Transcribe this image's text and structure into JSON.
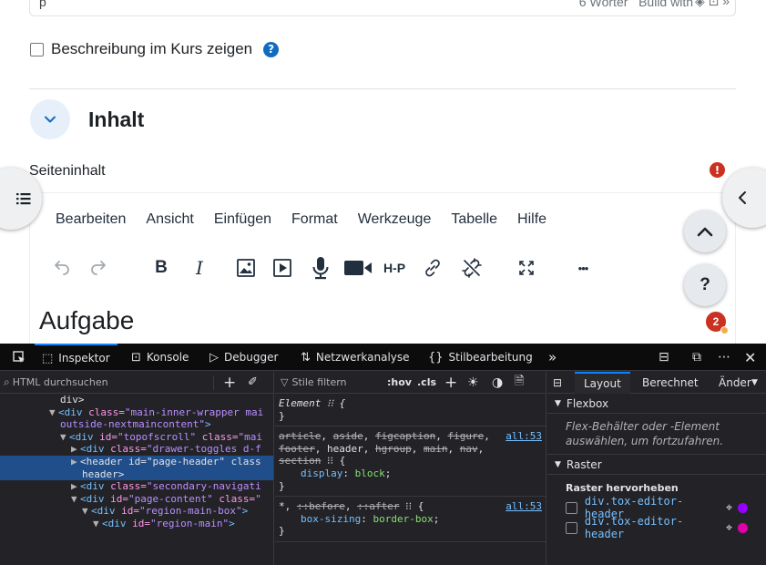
{
  "page": {
    "top_field": {
      "text": "p",
      "word_count": "6 Wörter",
      "build_with": "Build with"
    },
    "checkbox_label": "Beschreibung im Kurs zeigen",
    "help_icon": "?",
    "section_title": "Inhalt",
    "field_label": "Seiteninhalt",
    "required_icon": "!",
    "editor": {
      "menu": [
        "Bearbeiten",
        "Ansicht",
        "Einfügen",
        "Format",
        "Werkzeuge",
        "Tabelle",
        "Hilfe"
      ],
      "toolbar": [
        "undo-icon",
        "redo-icon",
        "bold-icon",
        "italic-icon",
        "image-icon",
        "media-icon",
        "microphone-icon",
        "video-icon",
        "h5p-icon",
        "link-icon",
        "unlink-icon",
        "fullscreen-icon",
        "more-icon"
      ],
      "bold_label": "B",
      "italic_label": "I",
      "h5p_label": "H-P",
      "more_label": "•••",
      "body_text": "Aufgabe"
    },
    "question_label": "?",
    "notification_count": "2",
    "colors": {
      "primary": "#0f6cbf",
      "danger": "#ca3120",
      "warning": "#f0ad4e"
    }
  },
  "devtools": {
    "tabs": [
      {
        "label": "Inspektor",
        "icon": "inspector-icon"
      },
      {
        "label": "Konsole",
        "icon": "console-icon"
      },
      {
        "label": "Debugger",
        "icon": "debugger-icon"
      },
      {
        "label": "Netzwerkanalyse",
        "icon": "network-icon"
      },
      {
        "label": "Stilbearbeitung",
        "icon": "style-editor-icon"
      }
    ],
    "more_tabs": "»",
    "html_search_placeholder": "HTML durchsuchen",
    "html_tree": [
      {
        "indent": 0,
        "parts": [
          [
            "txt",
            "div>"
          ]
        ]
      },
      {
        "indent": 1,
        "tri": "▼",
        "parts": [
          [
            "tag",
            "<div "
          ],
          [
            "attr",
            "class="
          ],
          [
            "val",
            "\"main-inner-wrapper mai"
          ]
        ]
      },
      {
        "indent": 1,
        "parts": [
          [
            "val",
            "outside-nextmaincontent\""
          ],
          [
            "tag",
            ">"
          ]
        ]
      },
      {
        "indent": 2,
        "tri": "▼",
        "parts": [
          [
            "tag",
            "<div "
          ],
          [
            "attr",
            "id="
          ],
          [
            "val",
            "\"topofscroll\" "
          ],
          [
            "attr",
            "class="
          ],
          [
            "val",
            "\"mai"
          ]
        ]
      },
      {
        "indent": 3,
        "tri": "▶",
        "parts": [
          [
            "tag",
            "<div "
          ],
          [
            "attr",
            "class="
          ],
          [
            "val",
            "\"drawer-toggles d-f"
          ]
        ]
      },
      {
        "indent": 3,
        "tri": "▶",
        "sel": true,
        "parts": [
          [
            "txt",
            "<header id=\"page-header\" class"
          ]
        ]
      },
      {
        "indent": 3,
        "sel": true,
        "parts": [
          [
            "txt",
            "header>"
          ]
        ]
      },
      {
        "indent": 3,
        "tri": "▶",
        "parts": [
          [
            "tag",
            "<div "
          ],
          [
            "attr",
            "class="
          ],
          [
            "val",
            "\"secondary-navigati"
          ]
        ]
      },
      {
        "indent": 3,
        "tri": "▼",
        "parts": [
          [
            "tag",
            "<div "
          ],
          [
            "attr",
            "id="
          ],
          [
            "val",
            "\"page-content\" "
          ],
          [
            "attr",
            "class="
          ],
          [
            "val",
            "\""
          ]
        ]
      },
      {
        "indent": 4,
        "tri": "▼",
        "parts": [
          [
            "tag",
            "<div "
          ],
          [
            "attr",
            "id="
          ],
          [
            "val",
            "\"region-main-box\""
          ],
          [
            "tag",
            ">"
          ]
        ]
      },
      {
        "indent": 5,
        "tri": "▼",
        "parts": [
          [
            "tag",
            "<div "
          ],
          [
            "attr",
            "id="
          ],
          [
            "val",
            "\"region-main\""
          ],
          [
            "tag",
            ">"
          ]
        ]
      }
    ],
    "rules_filter_placeholder": "Stile filtern",
    "rules_tools": [
      ":hov",
      ".cls"
    ],
    "rules": [
      {
        "selector": "Element",
        "italic": true,
        "decls": []
      },
      {
        "selector_html": "<span class='strike'>article</span>, <span class='strike'>aside</span>, <span class='strike'>figcaption</span>, <span class='strike'>figure</span>,<br><span class='strike'>footer</span>, header, <span class='strike'>hgroup</span>, <span class='strike'>main</span>, <span class='strike'>nav</span>,<br><span class='strike'>section</span>",
        "source": "all:53",
        "decls": [
          [
            "display",
            "block"
          ]
        ]
      },
      {
        "selector_html": "*, <span class='strike'>::before</span>, <span class='strike'>::after</span>",
        "source": "all:53",
        "decls": [
          [
            "box-sizing",
            "border-box"
          ]
        ]
      }
    ],
    "layout_tabs": [
      "Layout",
      "Berechnet",
      "Änder"
    ],
    "flexbox_title": "Flexbox",
    "flexbox_note": "Flex-Behälter oder -Element auswählen, um fortzufahren.",
    "grid_title": "Raster",
    "grid_highlight": "Raster hervorheben",
    "grid_items": [
      {
        "label": "div.tox-editor-header",
        "color": "#9400ff"
      },
      {
        "label": "div.tox-editor-header",
        "color": "#df00a9"
      }
    ]
  }
}
